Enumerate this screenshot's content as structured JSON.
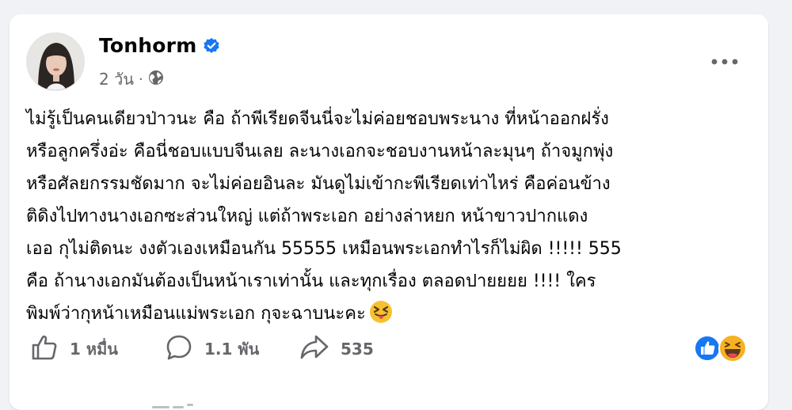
{
  "post": {
    "author": "Tonhorm",
    "time": "2 วัน",
    "separator": "·",
    "lines": [
      "ไม่รู้เป็นคนเดียวป่าวนะ คือ ถ้าพีเรียดจีนนี่จะไม่ค่อยชอบพระนาง ที่หน้าออกฝรั่ง",
      "หรือลูกครึ่งอ่ะ คือนี่ชอบแบบจีนเลย ละนางเอกจะชอบงานหน้าละมุนๆ ถ้าจมูกพุ่ง",
      "หรือศัลยกรรมชัดมาก จะไม่ค่อยอินละ มันดูไม่เข้ากะพีเรียดเท่าไหร่ คือค่อนข้าง",
      "ติดิงไปทางนางเอกซะส่วนใหญ่ แต่ถ้าพระเอก อย่างล่าหยก หน้าขาวปากแดง",
      "เออ กุไม่ติดนะ งงตัวเองเหมือนกัน 55555 เหมือนพระเอกทำไรก็ไม่ผิด !!!!! 555",
      "คือ ถ้านางเอกมันต้องเป็นหน้าเราเท่านั้น และทุกเรื่อง ตลอดปายยยย !!!! ใคร",
      "พิมพ์ว่ากุหน้าเหมือนแม่พระเอก กุจะฉาบนะคะ"
    ],
    "emoji": "squinting-tongue-emoji"
  },
  "actions": {
    "like_count": "1 หมื่น",
    "comment_count": "1.1 พัน",
    "share_count": "535"
  },
  "colors": {
    "background": "#f0f2f5",
    "card": "#ffffff",
    "text": "#050505",
    "secondary": "#65676b",
    "verified": "#1877f2",
    "like_reaction": "#1877f2",
    "haha_reaction": "#f7b125"
  }
}
